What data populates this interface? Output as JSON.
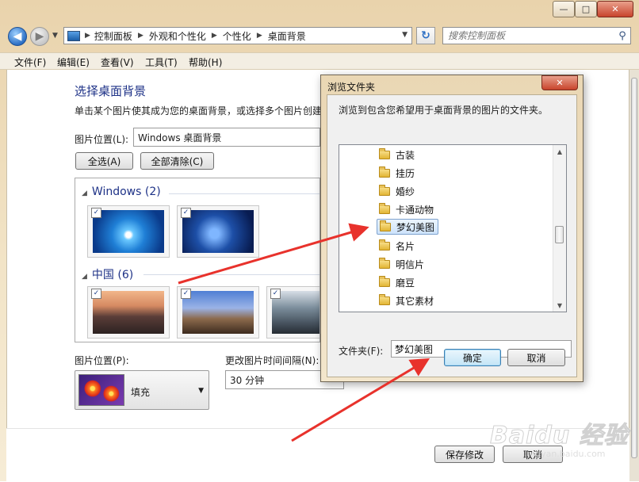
{
  "window": {
    "controls": {
      "minimize": "—",
      "maximize": "□",
      "close": "✕"
    }
  },
  "nav": {
    "back_icon": "back-arrow-icon",
    "forward_icon": "forward-arrow-icon",
    "breadcrumb": [
      "控制面板",
      "外观和个性化",
      "个性化",
      "桌面背景"
    ],
    "search_placeholder": "搜索控制面板"
  },
  "menu": [
    "文件(F)",
    "编辑(E)",
    "查看(V)",
    "工具(T)",
    "帮助(H)"
  ],
  "page": {
    "title": "选择桌面背景",
    "subtitle": "单击某个图片使其成为您的桌面背景，或选择多个图片创建",
    "location_label": "图片位置(L):",
    "location_value": "Windows 桌面背景",
    "select_all": "全选(A)",
    "clear_all": "全部清除(C)",
    "groups": [
      {
        "name": "Windows (2)"
      },
      {
        "name": "中国 (6)"
      }
    ],
    "position_label": "图片位置(P):",
    "position_value": "填充",
    "interval_label": "更改图片时间间隔(N):",
    "interval_value": "30 分钟",
    "save_button": "保存修改",
    "cancel_button": "取消"
  },
  "dialog": {
    "title": "浏览文件夹",
    "close": "✕",
    "description": "浏览到包含您希望用于桌面背景的图片的文件夹。",
    "folders": [
      "古装",
      "挂历",
      "婚纱",
      "卡通动物",
      "梦幻美图",
      "名片",
      "明信片",
      "磨豆",
      "其它素材"
    ],
    "selected_folder": "梦幻美图",
    "folder_label": "文件夹(F):",
    "folder_value": "梦幻美图",
    "ok": "确定",
    "cancel": "取消"
  },
  "watermark": {
    "brand": "Baidu 经验",
    "url": "jingyan.baidu.com"
  },
  "colors": {
    "annotation_arrow": "#e8322c",
    "selection": "#cde3fb",
    "heading": "#1e3287"
  }
}
